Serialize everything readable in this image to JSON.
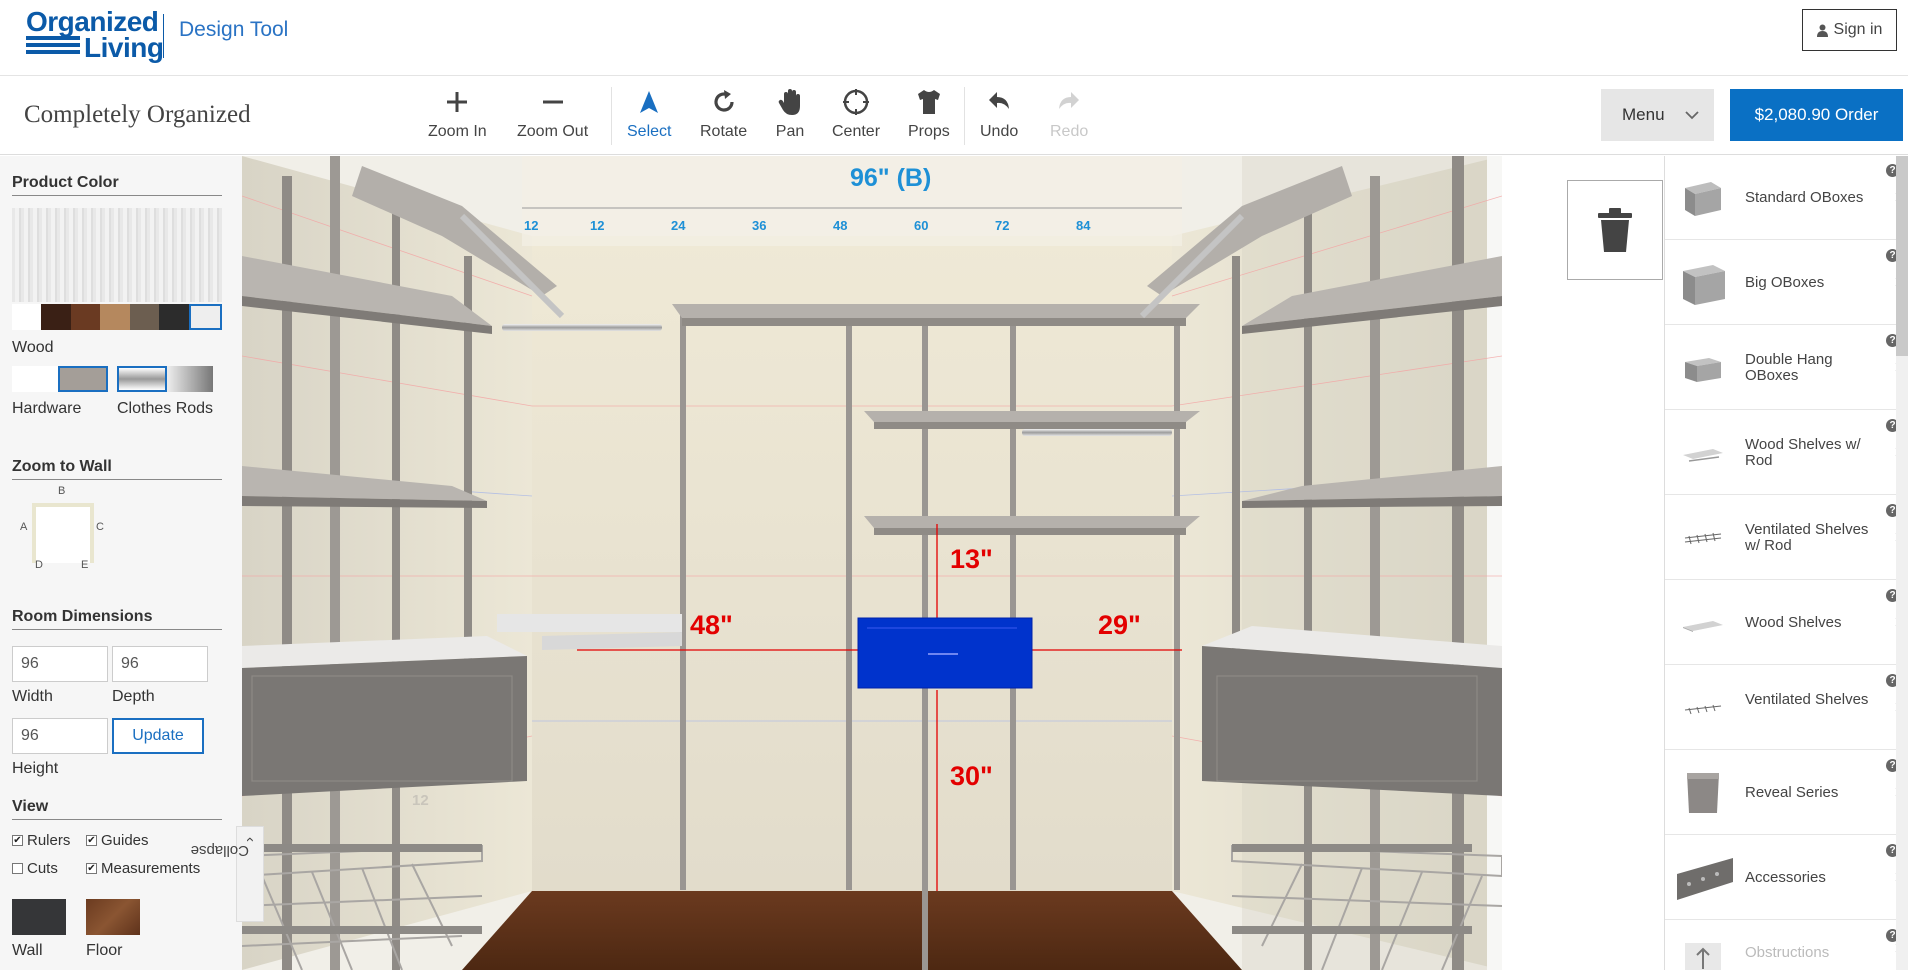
{
  "header": {
    "logo_line1": "Organized",
    "logo_line2": "Living",
    "tool_name": "Design Tool",
    "signin_label": "Sign in"
  },
  "toolbar": {
    "design_name": "Completely Organized",
    "tools": {
      "zoom_in": "Zoom In",
      "zoom_out": "Zoom Out",
      "select": "Select",
      "rotate": "Rotate",
      "pan": "Pan",
      "center": "Center",
      "props": "Props",
      "undo": "Undo",
      "redo": "Redo"
    },
    "menu_label": "Menu",
    "order_label": "$2,080.90 Order"
  },
  "left_panel": {
    "product_color_title": "Product Color",
    "wood_label": "Wood",
    "hardware_label": "Hardware",
    "clothes_rods_label": "Clothes Rods",
    "zoom_to_wall_title": "Zoom to Wall",
    "walls": {
      "a": "A",
      "b": "B",
      "c": "C",
      "d": "D",
      "e": "E"
    },
    "room_dimensions_title": "Room Dimensions",
    "width_value": "96",
    "width_label": "Width",
    "depth_value": "96",
    "depth_label": "Depth",
    "height_value": "96",
    "height_label": "Height",
    "update_label": "Update",
    "view_title": "View",
    "view_options": {
      "rulers": "Rulers",
      "guides": "Guides",
      "cuts": "Cuts",
      "measurements": "Measurements"
    },
    "view_checked": {
      "rulers": true,
      "guides": true,
      "cuts": false,
      "measurements": true
    },
    "wall_label": "Wall",
    "floor_label": "Floor",
    "collapse_label": "Collapse"
  },
  "scene": {
    "ruler_title": "96\" (B)",
    "ruler_ticks": [
      "12",
      "12",
      "24",
      "36",
      "48",
      "60",
      "72",
      "84"
    ],
    "dim_top": "13\"",
    "dim_left": "48\"",
    "dim_right": "29\"",
    "dim_bottom": "30\"",
    "side_wall_tick": "12"
  },
  "products": [
    {
      "name": "Standard OBoxes",
      "help": "?"
    },
    {
      "name": "Big OBoxes",
      "help": "?"
    },
    {
      "name": "Double Hang OBoxes",
      "help": "?"
    },
    {
      "name": "Wood Shelves w/ Rod",
      "help": "?"
    },
    {
      "name": "Ventilated Shelves w/ Rod",
      "help": "?"
    },
    {
      "name": "Wood Shelves",
      "help": "?"
    },
    {
      "name": "Ventilated Shelves",
      "help": "?"
    },
    {
      "name": "Reveal Series",
      "help": "?"
    },
    {
      "name": "Accessories",
      "help": "?"
    },
    {
      "name": "Obstructions",
      "help": "?"
    }
  ],
  "colors": {
    "brand_blue": "#0b5aa8",
    "accent_blue": "#0a70c4",
    "selected_box": "#0033cc",
    "dimension_red": "#e30000",
    "ruler_blue": "#1e90d6"
  }
}
